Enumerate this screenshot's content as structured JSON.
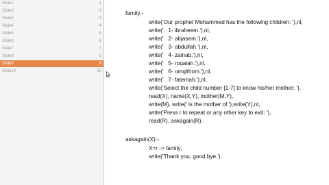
{
  "sidebar": {
    "items": [
      {
        "label": "Slide1",
        "num": "1"
      },
      {
        "label": "Slide2",
        "num": "2"
      },
      {
        "label": "Slide3",
        "num": "3"
      },
      {
        "label": "Slide4",
        "num": "4"
      },
      {
        "label": "Slide5",
        "num": "5"
      },
      {
        "label": "Slide6",
        "num": "6"
      },
      {
        "label": "Slide7",
        "num": "7"
      },
      {
        "label": "Slide8",
        "num": "8"
      },
      {
        "label": "Slide9",
        "num": "9"
      },
      {
        "label": "Slide10",
        "num": "10"
      }
    ],
    "selected_index": 8,
    "selected_color": "#e8874a"
  },
  "code": {
    "lines": [
      "family:-",
      "write('Our prophet Mohammed has the following children: '),nl,",
      "write('   1- ibraheem.'),nl,",
      "write('   2- alqasem.'),nl,",
      "write('   3- abdullah.'),nl,",
      "write('   4- zainab.'),nl,",
      "write('   5- roqaiah.'),nl,",
      "write('   6- omqlthom.'),nl,",
      "write('   7- fatemah.'),nl,",
      "write('Select the child number [1-7] to know his/her mother: '),",
      "read(X), name(X,Y), mother(M,Y),",
      "write(M), write(' is the mother of '),write(Y),nl,",
      "write('Press r to repeat or any other key to exit: '),",
      "read(R), askagain(R).",
      "askagain(X):-",
      "X=r -> family;",
      "write('Thank you, good bye.')."
    ]
  }
}
